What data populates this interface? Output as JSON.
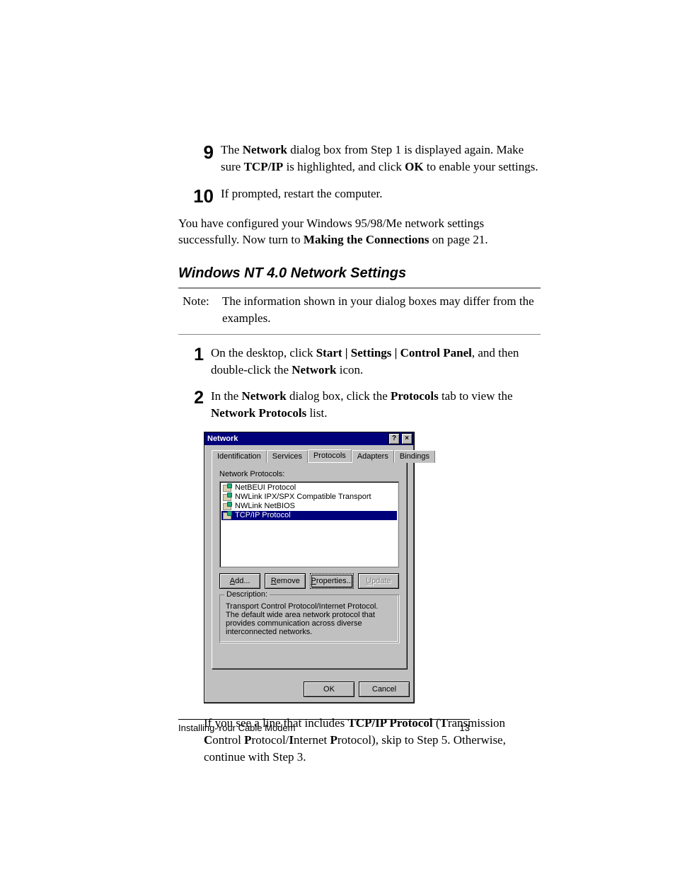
{
  "steps_top": [
    {
      "num": "9",
      "html": "The <b>Network</b> dialog box from Step 1 is displayed again. Make sure <b>TCP/IP</b> is highlighted, and click <b>OK</b> to enable your settings."
    },
    {
      "num": "10",
      "html": "If prompted, restart the computer."
    }
  ],
  "paragraph_after_steps": "You have configured your Windows 95/98/Me network settings successfully. Now turn to <b>Making the Connections</b> on page 21.",
  "section_heading": "Windows NT 4.0 Network Settings",
  "note": {
    "label": "Note:",
    "body": "The information shown in your dialog boxes may differ from the examples."
  },
  "steps_section": [
    {
      "num": "1",
      "html": "On the desktop, click <b>Start | Settings | Control Panel</b>, and then double-click the <b>Network</b> icon."
    },
    {
      "num": "2",
      "html": "In the <b>Network</b> dialog box, click the <b>Protocols</b> tab to view the <b>Network Protocols</b> list."
    }
  ],
  "dialog": {
    "title": "Network",
    "tabs": [
      "Identification",
      "Services",
      "Protocols",
      "Adapters",
      "Bindings"
    ],
    "active_tab": "Protocols",
    "list_label": "Network Protocols:",
    "protocols": [
      {
        "name": "NetBEUI Protocol",
        "selected": false
      },
      {
        "name": "NWLink IPX/SPX Compatible Transport",
        "selected": false
      },
      {
        "name": "NWLink NetBIOS",
        "selected": false
      },
      {
        "name": "TCP/IP Protocol",
        "selected": true
      }
    ],
    "buttons": {
      "add": "Add...",
      "remove": "Remove",
      "properties": "Properties...",
      "update": "Update"
    },
    "description_label": "Description:",
    "description_text": "Transport Control Protocol/Internet Protocol. The default wide area network protocol that provides communication across diverse interconnected networks.",
    "ok": "OK",
    "cancel": "Cancel"
  },
  "paragraph_after_dialog": "If you see a line that includes <b>TCP/IP Protocol</b> (<b>T</b>ransmission <b>C</b>ontrol <b>P</b>rotocol/<b>I</b>nternet <b>P</b>rotocol), skip to Step 5. Otherwise, continue with Step 3.",
  "footer": {
    "left": "Installing Your Cable Modem",
    "right": "13"
  }
}
